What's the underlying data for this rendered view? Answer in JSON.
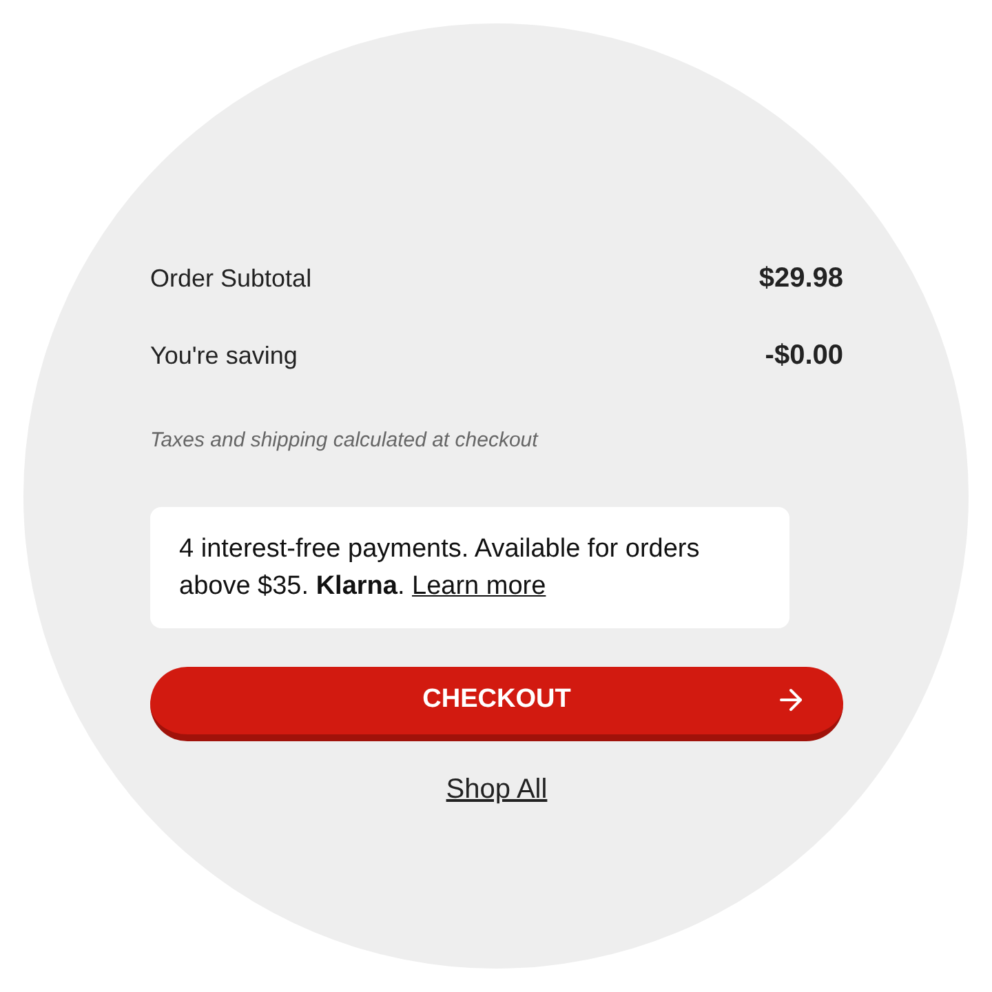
{
  "summary": [
    {
      "label": "Order Subtotal",
      "value": "$29.98"
    },
    {
      "label": "You're saving",
      "value": "-$0.00"
    }
  ],
  "note": "Taxes and shipping calculated at checkout",
  "klarna": {
    "message": "4 interest-free payments. Available for orders above $35. **Klarna**.",
    "link": "Learn more"
  },
  "checkout_button": "CHECKOUT",
  "shop_all_link": "Shop All"
}
